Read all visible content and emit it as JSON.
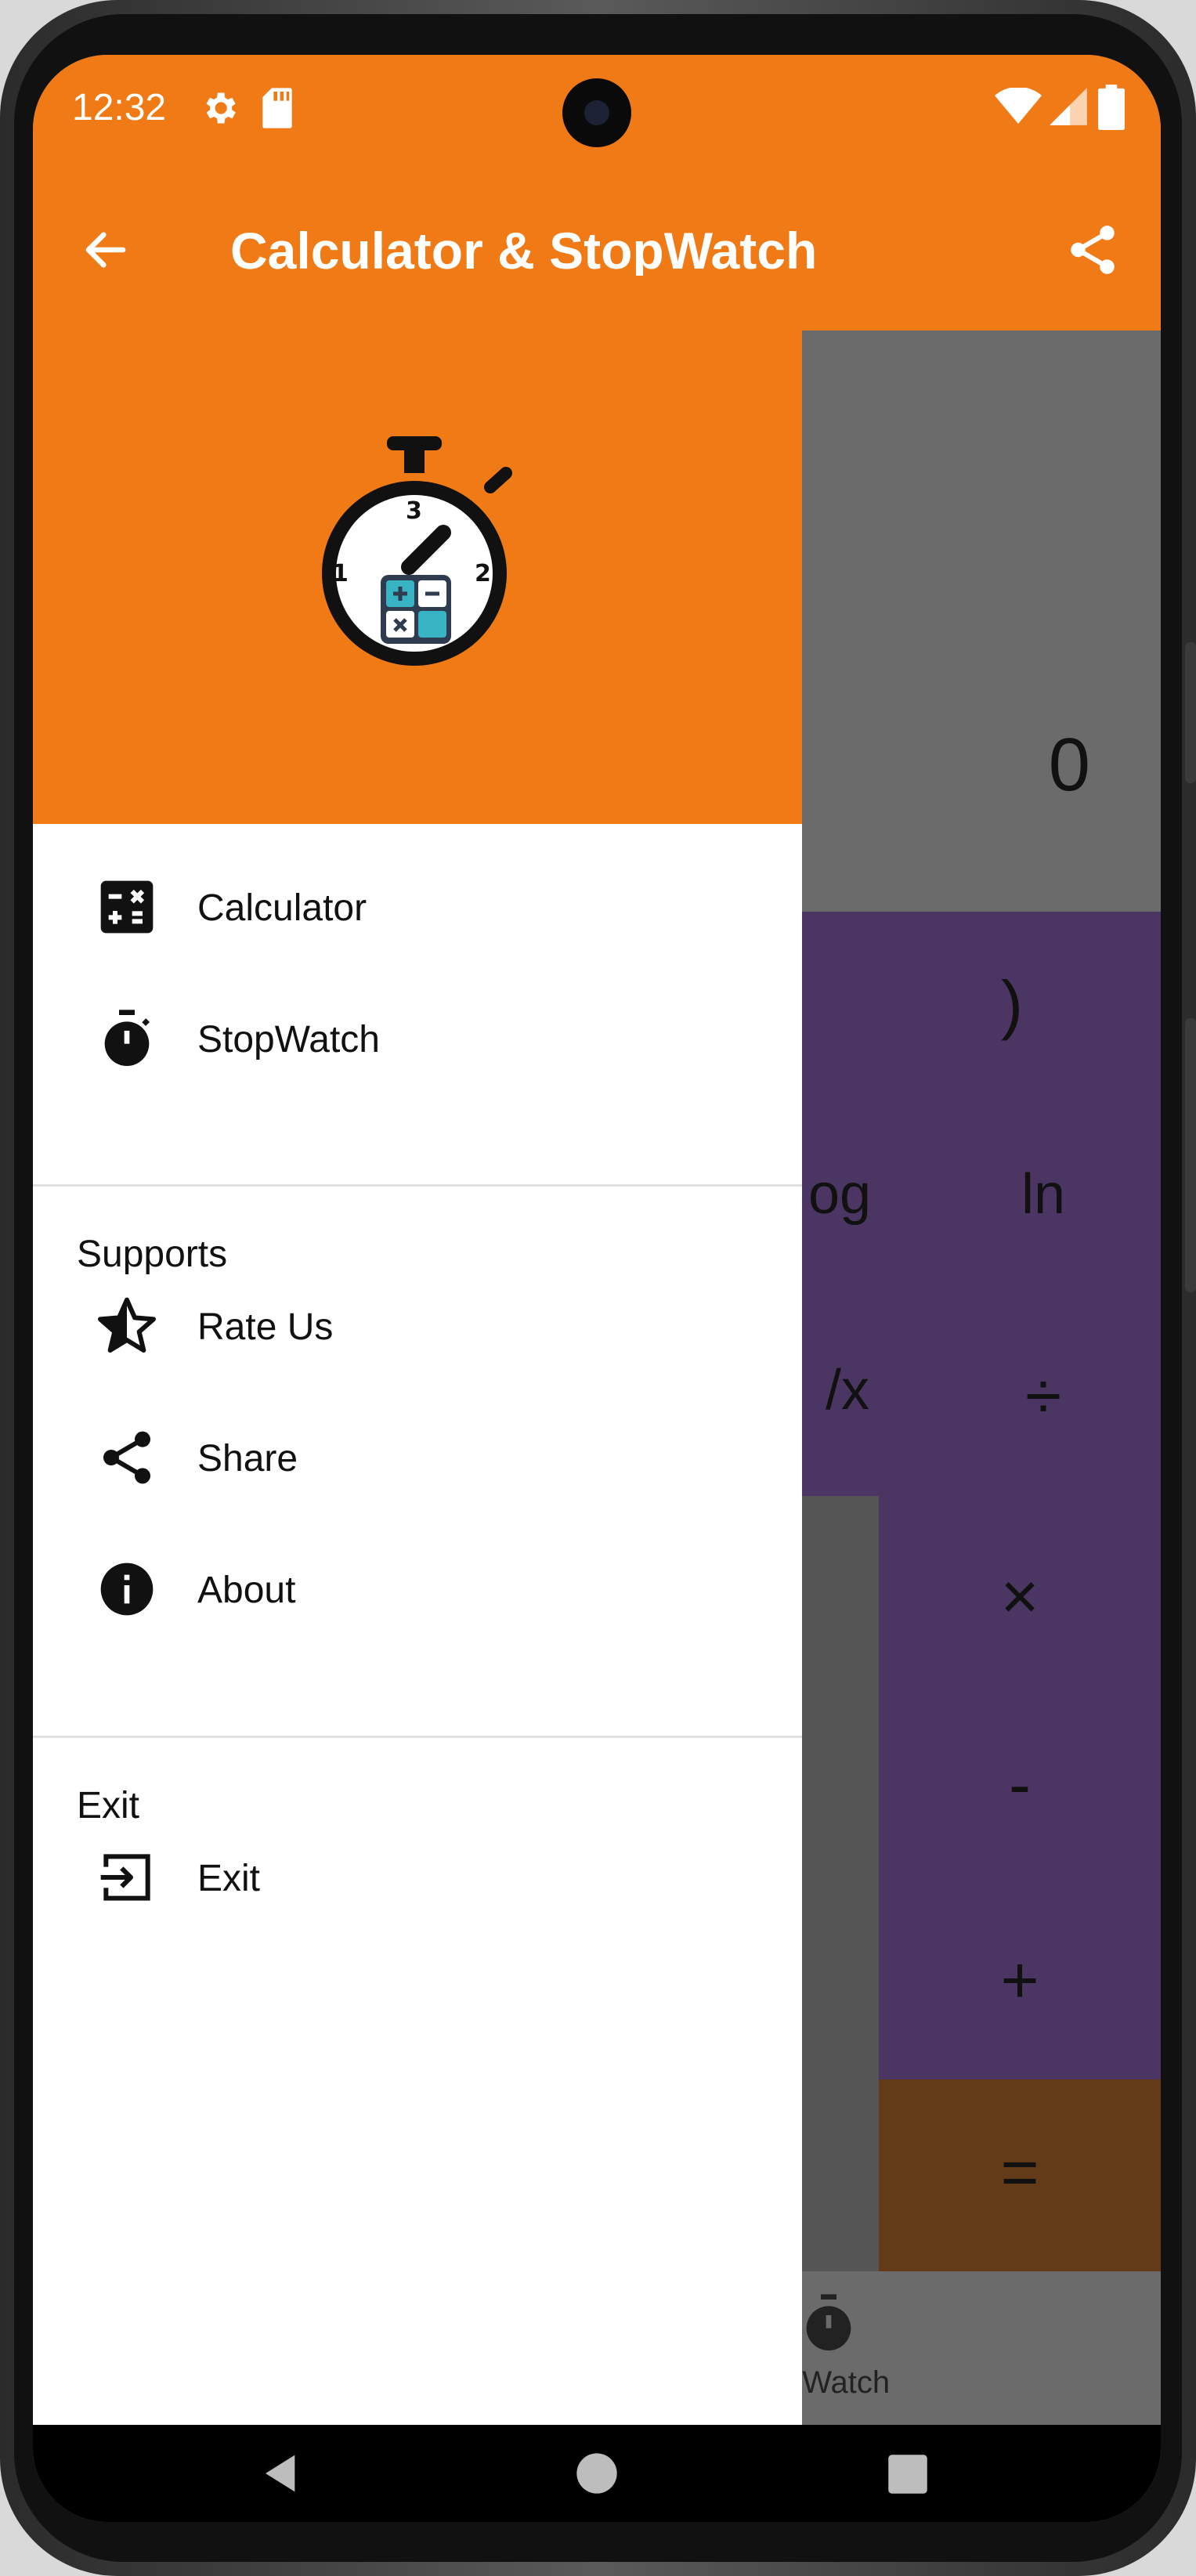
{
  "status_bar": {
    "time": "12:32"
  },
  "app_bar": {
    "title": "Calculator & StopWatch"
  },
  "calculator": {
    "display_value": "0",
    "keys": {
      "close_paren": ")",
      "log": "og",
      "ln": "ln",
      "inverse": "/x",
      "divide": "÷",
      "multiply": "×",
      "subtract": "-",
      "add": "+",
      "equals": "="
    }
  },
  "bottom_nav": {
    "stopwatch_label": "pWatch"
  },
  "drawer": {
    "items_main": [
      {
        "label": "Calculator",
        "icon": "calculator-icon"
      },
      {
        "label": "StopWatch",
        "icon": "timer-icon"
      }
    ],
    "supports_header": "Supports",
    "items_support": [
      {
        "label": "Rate Us",
        "icon": "star-half-icon"
      },
      {
        "label": "Share",
        "icon": "share-icon"
      },
      {
        "label": "About",
        "icon": "info-icon"
      }
    ],
    "exit_header": "Exit",
    "items_exit": [
      {
        "label": "Exit",
        "icon": "exit-icon"
      }
    ]
  },
  "colors": {
    "accent": "#f07b16",
    "sci_keys": "#4b3563",
    "equals": "#633b19"
  }
}
